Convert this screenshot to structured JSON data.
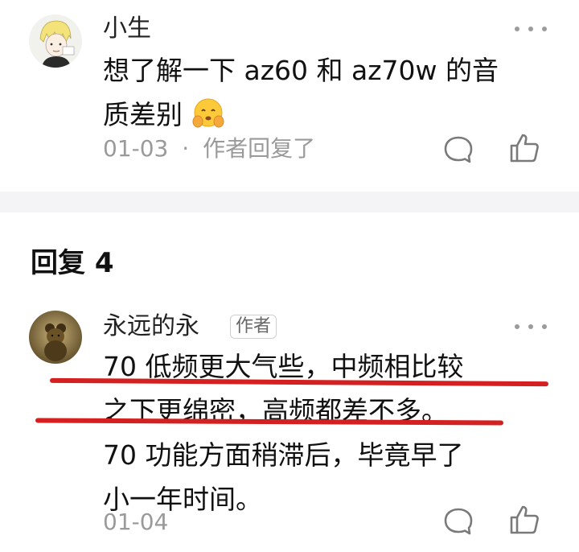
{
  "top_comment": {
    "username": "小生",
    "text_line1": "想了解一下 az60 和 az70w 的音",
    "text_line2": "质差别",
    "emoji": "face-with-hand-emoji",
    "date": "01-03",
    "separator": "·",
    "reply_status": "作者回复了"
  },
  "replies": {
    "header": "回复 4",
    "items": [
      {
        "username": "永远的永",
        "tag": "作者",
        "lines": [
          "70 低频更大气些，中频相比较",
          "之下更绵密，高频都差不多。",
          "70 功能方面稍滞后，毕竟早了",
          "小一年时间。"
        ],
        "date": "01-04"
      }
    ]
  },
  "icons": {
    "more": "more-dots-icon",
    "comment": "comment-bubble-icon",
    "like": "thumbs-up-icon"
  },
  "colors": {
    "annotation_line": "#d42020",
    "meta_text": "#9a9a9a",
    "divider_band": "#f4f4f6"
  }
}
